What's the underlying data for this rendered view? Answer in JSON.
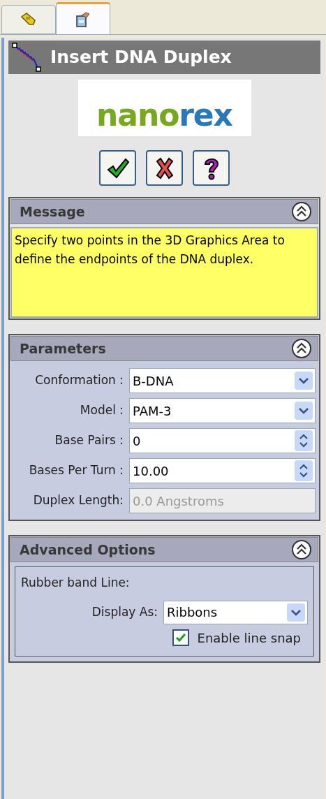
{
  "tabs": [
    {
      "kind": "build",
      "selected": false
    },
    {
      "kind": "properties",
      "selected": true
    }
  ],
  "title": "Insert DNA Duplex",
  "logo": {
    "parts": [
      "nano",
      "rex"
    ]
  },
  "buttons": [
    {
      "kind": "ok"
    },
    {
      "kind": "cancel"
    },
    {
      "kind": "help"
    }
  ],
  "sections": [
    {
      "title": "Message",
      "expanded": true,
      "kind": "message",
      "text": "Specify two points in the 3D Graphics Area to define the endpoints of the DNA duplex."
    },
    {
      "title": "Parameters",
      "expanded": true,
      "kind": "form",
      "fields": [
        {
          "label": "Conformation :",
          "kind": "combo",
          "value": "B-DNA"
        },
        {
          "label": "Model :",
          "kind": "combo",
          "value": "PAM-3"
        },
        {
          "label": "Base Pairs :",
          "kind": "spin",
          "value": "0"
        },
        {
          "label": "Bases Per Turn :",
          "kind": "spin",
          "value": "10.00"
        },
        {
          "label": "Duplex Length:",
          "kind": "readonly",
          "value": "0.0 Angstroms"
        }
      ]
    },
    {
      "title": "Advanced Options",
      "expanded": true,
      "kind": "advanced",
      "group_label": "Rubber band Line:",
      "display_label": "Display As:",
      "display_value": "Ribbons",
      "checkbox": {
        "label": "Enable line snap",
        "checked": true
      }
    }
  ]
}
